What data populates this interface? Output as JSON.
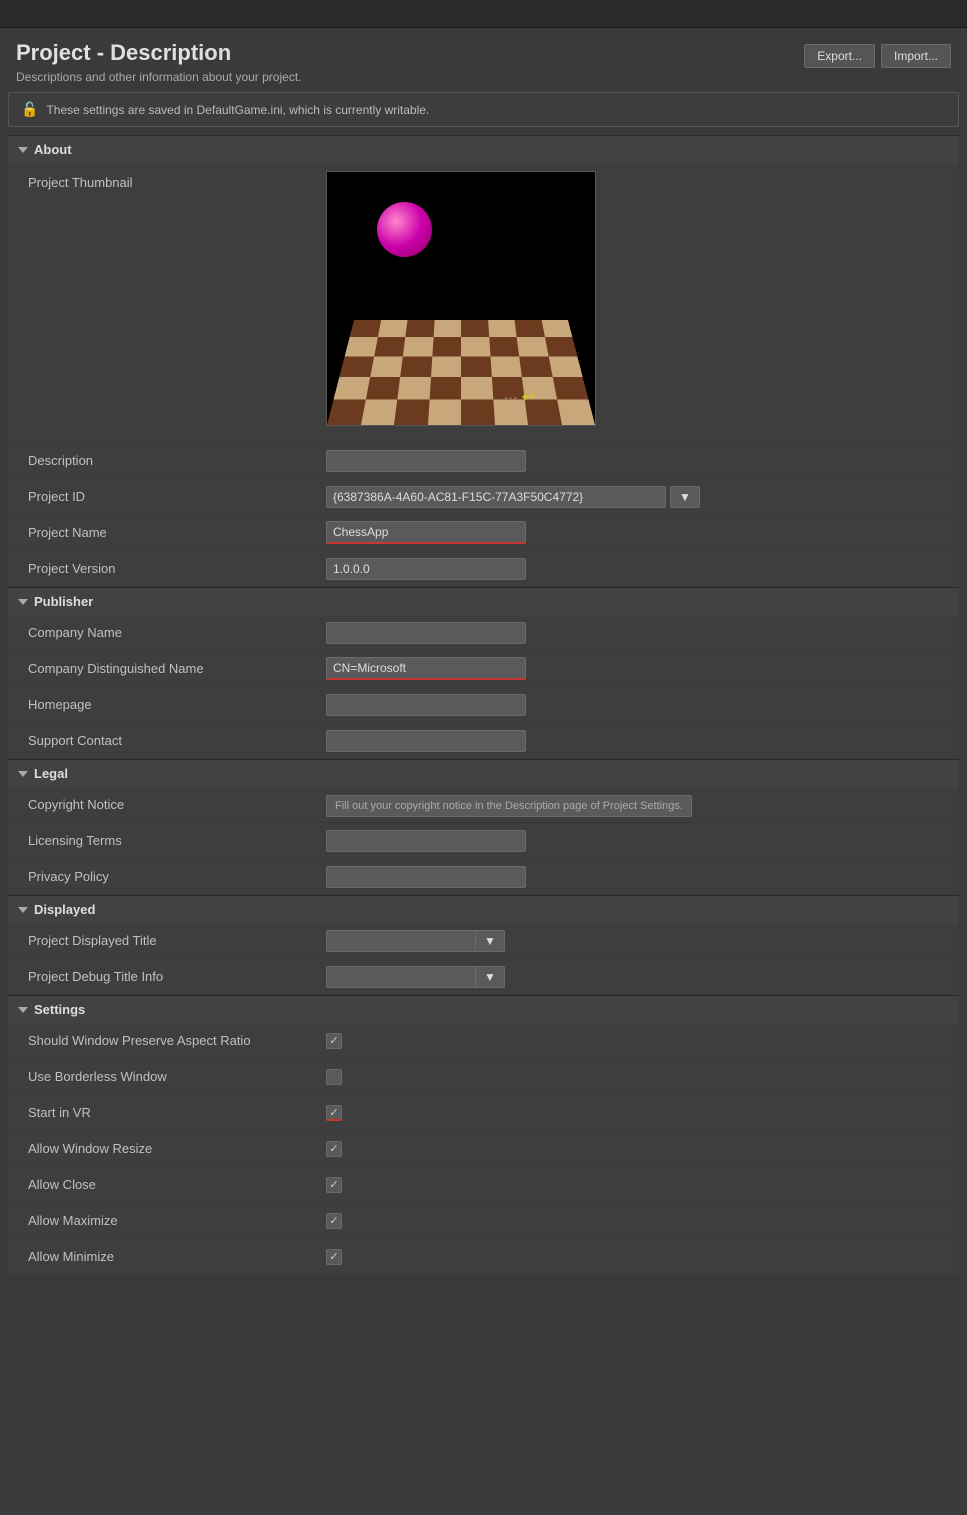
{
  "topBar": {
    "searchPlaceholder": ""
  },
  "page": {
    "title": "Project - Description",
    "subtitle": "Descriptions and other information about your project.",
    "exportLabel": "Export...",
    "importLabel": "Import..."
  },
  "infoBanner": {
    "text": "These settings are saved in DefaultGame.ini, which is currently writable."
  },
  "sections": {
    "about": {
      "label": "About",
      "fields": {
        "projectThumbnail": "Project Thumbnail",
        "description": "Description",
        "projectId": "Project ID",
        "projectIdValue": "{6387386A-4A60-AC81-F15C-77A3F50C4772}",
        "projectName": "Project Name",
        "projectNameValue": "ChessApp",
        "projectVersion": "Project Version",
        "projectVersionValue": "1.0.0.0"
      }
    },
    "publisher": {
      "label": "Publisher",
      "fields": {
        "companyName": "Company Name",
        "companyNameValue": "",
        "companyDistinguishedName": "Company Distinguished Name",
        "companyDistinguishedNameValue": "CN=Microsoft",
        "homepage": "Homepage",
        "homepageValue": "",
        "supportContact": "Support Contact",
        "supportContactValue": ""
      }
    },
    "legal": {
      "label": "Legal",
      "fields": {
        "copyrightNotice": "Copyright Notice",
        "copyrightNoticeValue": "Fill out your copyright notice in the Description page of Project Settings.",
        "licensingTerms": "Licensing Terms",
        "licensingTermsValue": "",
        "privacyPolicy": "Privacy Policy",
        "privacyPolicyValue": ""
      }
    },
    "displayed": {
      "label": "Displayed",
      "fields": {
        "projectDisplayedTitle": "Project Displayed Title",
        "projectDisplayedTitleValue": "",
        "projectDebugTitleInfo": "Project Debug Title Info",
        "projectDebugTitleInfoValue": ""
      }
    },
    "settings": {
      "label": "Settings",
      "fields": {
        "shouldWindowPreserveAspectRatio": "Should Window Preserve Aspect Ratio",
        "shouldWindowPreserveAspectRatioChecked": true,
        "useBorderlessWindow": "Use Borderless Window",
        "useBorderlessWindowChecked": false,
        "startInVR": "Start in VR",
        "startInVRChecked": true,
        "allowWindowResize": "Allow Window Resize",
        "allowWindowResizeChecked": true,
        "allowClose": "Allow Close",
        "allowCloseChecked": true,
        "allowMaximize": "Allow Maximize",
        "allowMaximizeChecked": true,
        "allowMinimize": "Allow Minimize",
        "allowMinimizeChecked": true
      }
    }
  }
}
